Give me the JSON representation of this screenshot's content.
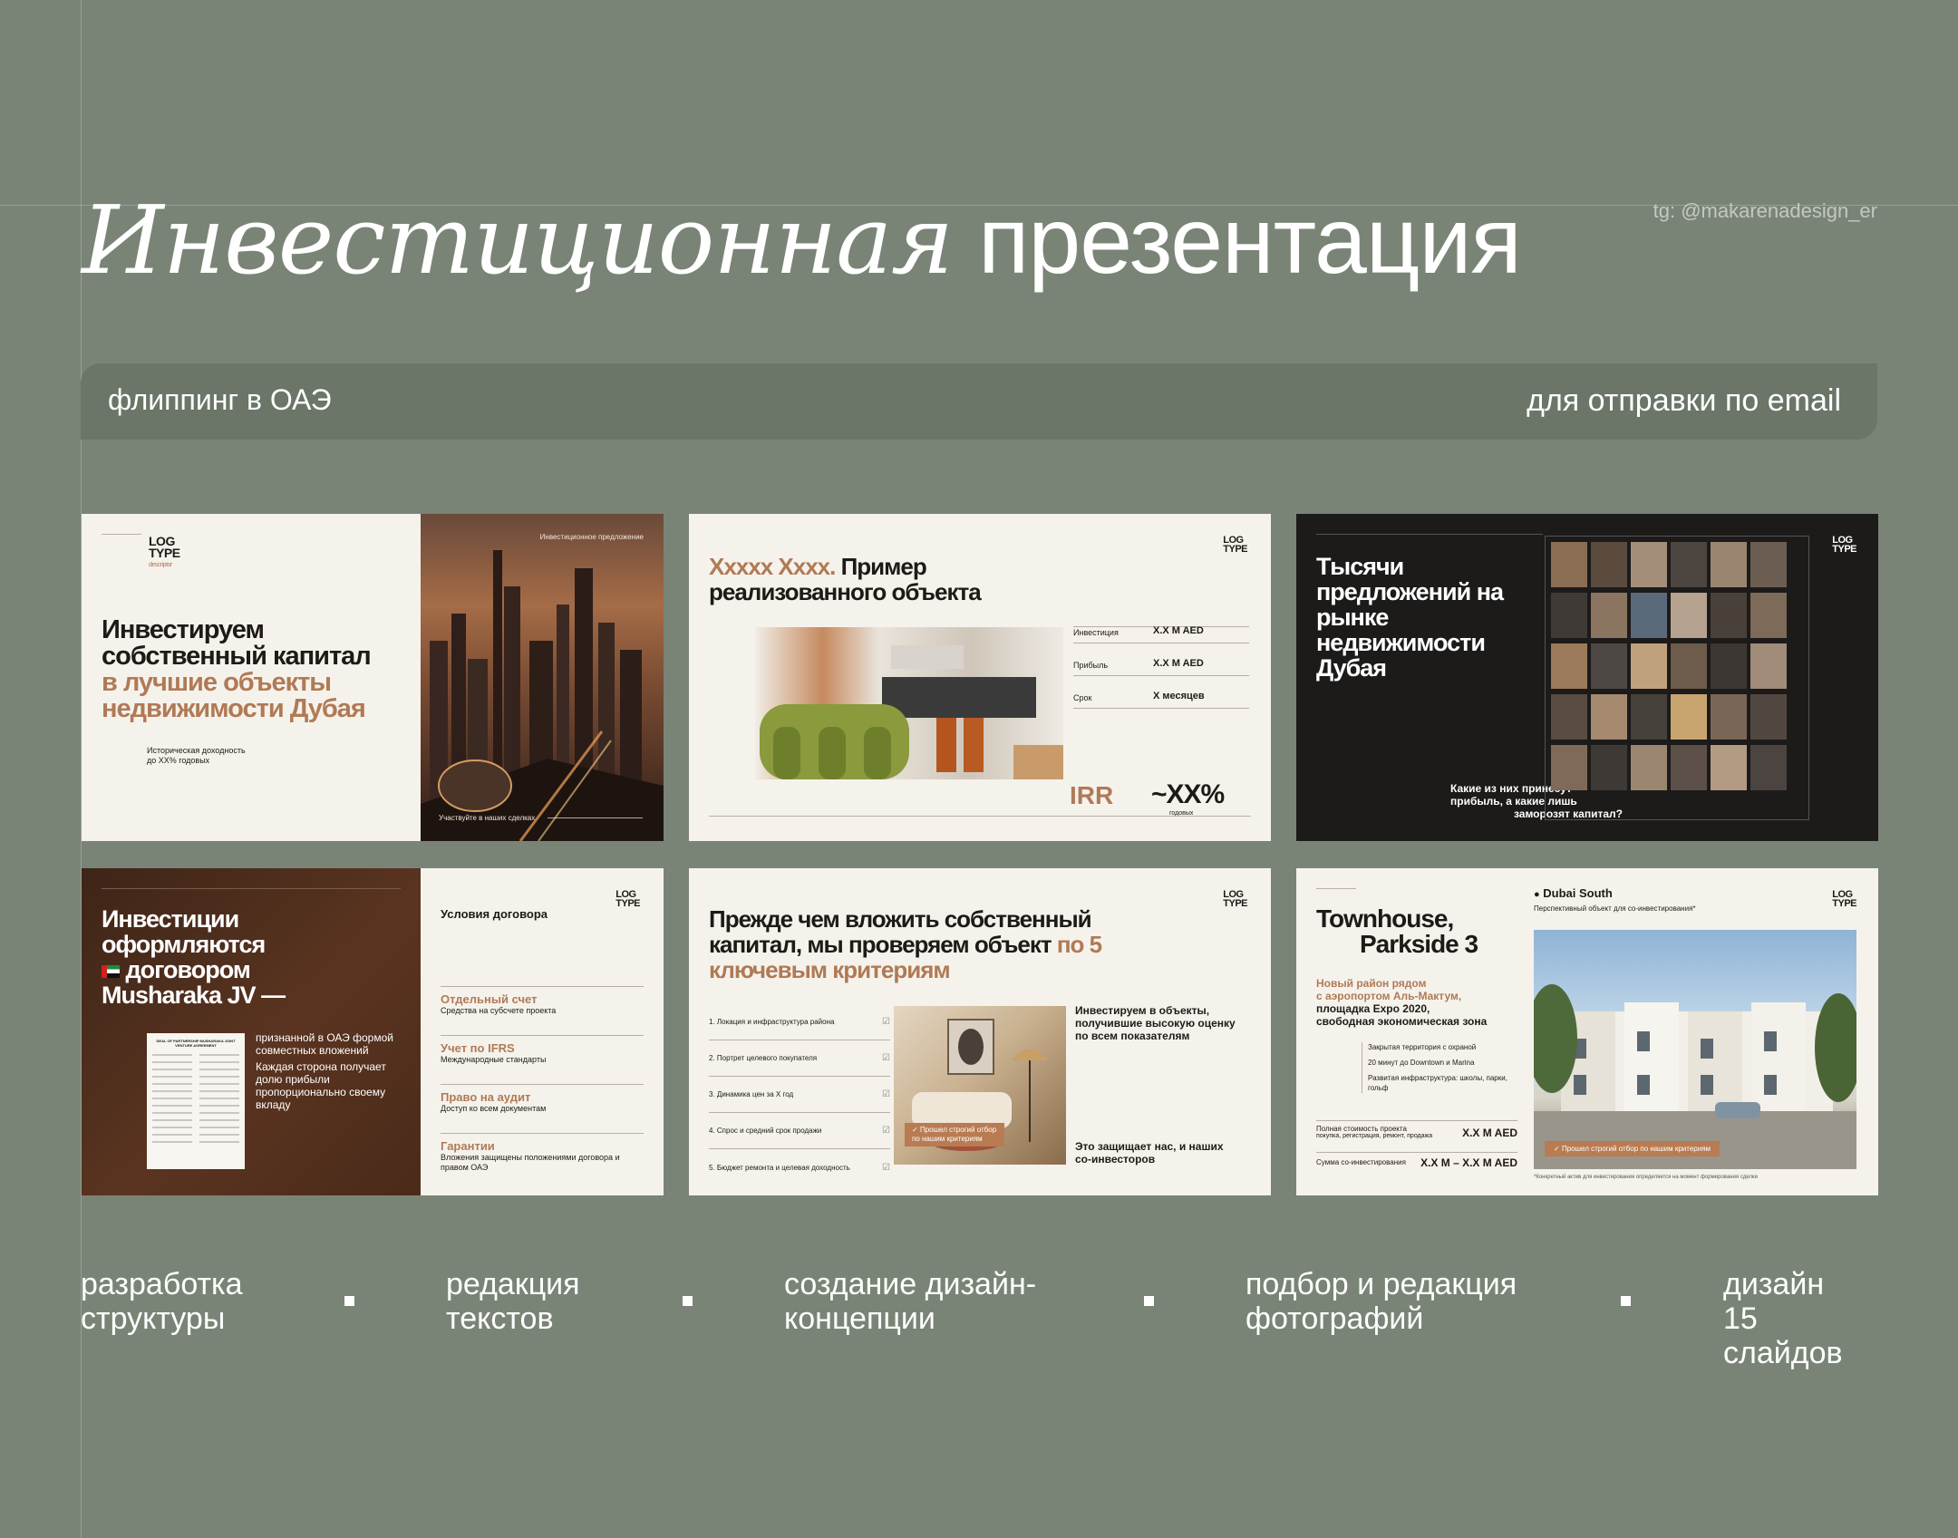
{
  "credit": "tg: @makarenadesign_er",
  "hero": {
    "italic": "Инвестиционная",
    "plain": "презентация"
  },
  "band": {
    "left": "флиппинг в ОАЭ",
    "right": "для отправки по email"
  },
  "slides": {
    "s1": {
      "logo_line1": "LOG",
      "logo_line2": "TYPE",
      "logo_sub": "descriptor",
      "title_dark": "Инвестируем собственный капитал",
      "title_accent": "в лучшие объекты недвижимости Дубая",
      "caption_l1": "Историческая доходность",
      "caption_l2": "до XX% годовых",
      "img_top": "Инвестиционное предложение",
      "img_bottom": "Участвуйте в наших сделках"
    },
    "s2": {
      "logo_line1": "LOG",
      "logo_line2": "TYPE",
      "title_accent": "Xxxxx Xxxx.",
      "title_dark1": "Пример",
      "title_dark2": "реализованного объекта",
      "rows": [
        {
          "label": "Инвестиция",
          "value": "X.X M AED"
        },
        {
          "label": "Прибыль",
          "value": "X.X M AED"
        },
        {
          "label": "Срок",
          "value": "X месяцев"
        }
      ],
      "irr": "IRR",
      "irr_value": "~XX%",
      "irr_sub": "годовых"
    },
    "s3": {
      "logo_line1": "LOG",
      "logo_line2": "TYPE",
      "title": "Тысячи предложений на рынке недвижимости Дубая",
      "q1": "Какие из них принесут",
      "q2": "прибыль, а какие лишь",
      "q3": "заморозят капитал?"
    },
    "s4": {
      "logo_line1": "LOG",
      "logo_line2": "TYPE",
      "title1": "Инвестиции",
      "title2": "оформляются",
      "title3": "договором",
      "title4": "Musharaka JV —",
      "desc1": "признанной в ОАЭ формой совместных вложений",
      "desc2": "Каждая сторона получает долю прибыли пропорционально своему вкладу",
      "doc_head": "DEAL OF PARTNERSHIP MUSHARAKA JOINT VENTURE AGREEMENT",
      "terms_title": "Условия договора",
      "terms": [
        {
          "t": "Отдельный счет",
          "d": "Средства на субсчете проекта"
        },
        {
          "t": "Учет по IFRS",
          "d": "Международные стандарты"
        },
        {
          "t": "Право на аудит",
          "d": "Доступ ко всем документам"
        },
        {
          "t": "Гарантии",
          "d": "Вложения защищены положениями договора и правом ОАЭ"
        }
      ]
    },
    "s5": {
      "logo_line1": "LOG",
      "logo_line2": "TYPE",
      "title_dark": "Прежде чем вложить собственный капитал, мы проверяем объект",
      "title_accent": "по 5 ключевым критериям",
      "criteria": [
        "1.  Локация и инфраструктура района",
        "2.  Портрет целевого покупателя",
        "3.  Динамика цен за X год",
        "4.  Спрос и средний срок продажи",
        "5.  Бюджет ремонта и целевая доходность"
      ],
      "badge": "Прошел строгий отбор по нашим критериям",
      "side1": "Инвестируем в объекты, получившие высокую оценку по всем показателям",
      "side2": "Это защищает нас, и наших со-инвесторов"
    },
    "s6": {
      "logo_line1": "LOG",
      "logo_line2": "TYPE",
      "title1": "Townhouse,",
      "title2": "Parkside 3",
      "location": "Dubai South",
      "loc_sub": "Перспективный объект для со-инвестирования*",
      "accent1": "Новый район рядом",
      "accent2": "с аэропортом Аль-Мактум,",
      "dark1": "площадка Expo 2020,",
      "dark2": "свободная экономическая зона",
      "bullets": [
        "Закрытая территория с охраной",
        "20 минут до Downtown и Marina",
        "Развитая инфраструктура: школы, парки, гольф"
      ],
      "price_label": "Полная стоимость проекта",
      "price_sub": "покупка, регистрация, ремонт, продажа",
      "price_value": "X.X M AED",
      "co_label": "Сумма со-инвестирования",
      "co_value": "X.X M – X.X M AED",
      "badge": "Прошел строгий отбор по нашим критериям",
      "foot": "*Конкретный актив для инвестирования определяется на момент формирования сделки"
    }
  },
  "features": [
    {
      "l1": "разработка",
      "l2": "структуры"
    },
    {
      "l1": "редакция",
      "l2": "текстов"
    },
    {
      "l1": "создание дизайн-",
      "l2": "концепции"
    },
    {
      "l1": "подбор и редакция",
      "l2": "фотографий"
    },
    {
      "l1": "дизайн",
      "l2": "15 слайдов"
    }
  ]
}
